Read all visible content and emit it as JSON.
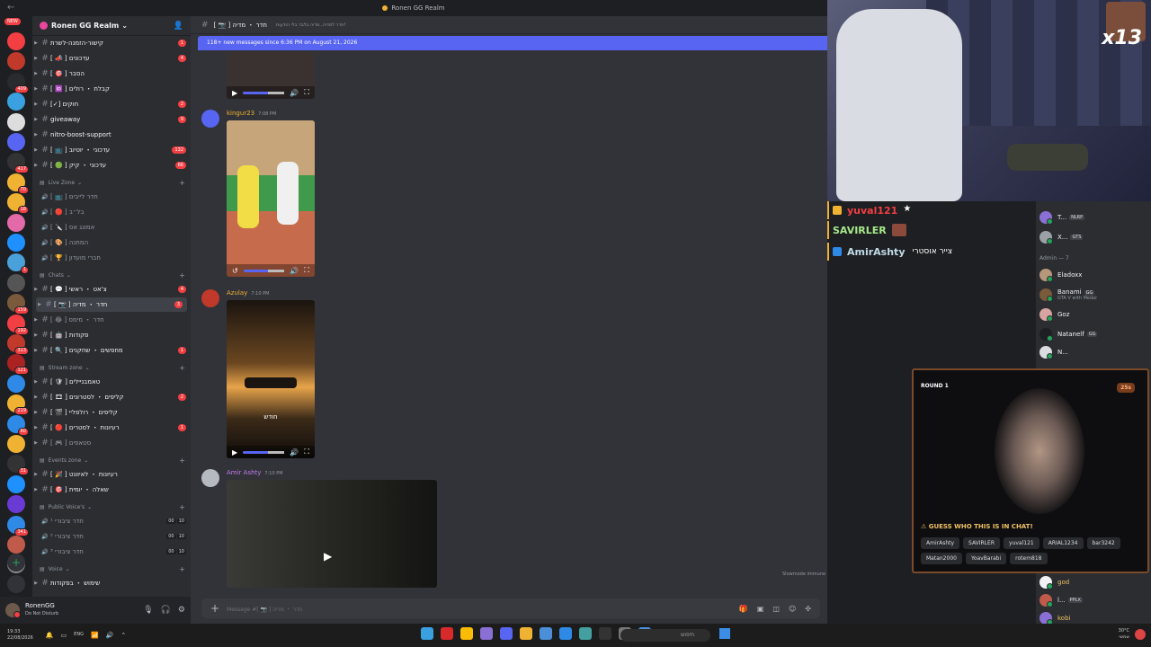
{
  "titlebar": {
    "title": "Ronen GG Realm",
    "back": "←"
  },
  "rail": {
    "new_badge": "NEW",
    "badges": [
      "",
      "",
      "409",
      "",
      "",
      "",
      "417",
      "70",
      "18",
      "",
      "",
      "1",
      "",
      "159",
      "192",
      "313",
      "121",
      "",
      "219",
      "60",
      "",
      "31",
      "",
      "",
      "341",
      "",
      ""
    ]
  },
  "server": {
    "name": "Ronen GG Realm",
    "chevron": "⌄"
  },
  "channels": [
    {
      "type": "text",
      "name": "קישור-הזמנה-לשרת",
      "badge": "1",
      "unread": true
    },
    {
      "type": "text",
      "name": "[ 📣 ] עדכונים",
      "badge": "4",
      "unread": true
    },
    {
      "type": "text",
      "name": "[ 🎯 ] הסבר",
      "badge": "",
      "unread": true
    },
    {
      "type": "text",
      "name": "[ 🆔 ] קבלת ・ רולים",
      "badge": "",
      "unread": true
    },
    {
      "type": "text",
      "name": "[✓] חוקים",
      "badge": "2",
      "unread": true
    },
    {
      "type": "text",
      "name": "giveaway",
      "badge": "9",
      "unread": true
    },
    {
      "type": "text",
      "name": "nitro-boost-support",
      "badge": "",
      "unread": true
    },
    {
      "type": "text",
      "name": "[ 📺 ] עדכוני ・ יוטיוב",
      "badge": "132",
      "unread": true
    },
    {
      "type": "text",
      "name": "[ 🟢 ] עדכוני ・ קיק",
      "badge": "66",
      "unread": true
    },
    {
      "type": "cat",
      "name": "Live Zone"
    },
    {
      "type": "voice",
      "name": "[ 📺 ] חדר לייבים"
    },
    {
      "type": "voice",
      "name": "[ 🔴 ] בל״ב"
    },
    {
      "type": "voice",
      "name": "[ 🔪 ] אמונג אס"
    },
    {
      "type": "voice",
      "name": "[ 🎨 ] המתנה"
    },
    {
      "type": "voice",
      "name": "[ 🏆 ] חברי מועדון"
    },
    {
      "type": "cat",
      "name": "Chats"
    },
    {
      "type": "text",
      "name": "[ 💬 ] צ'אט ・ ראשי",
      "badge": "4",
      "unread": true
    },
    {
      "type": "text",
      "name": "[ 📷 ] חדר ・ מדיה",
      "badge": "3",
      "unread": true,
      "selected": true
    },
    {
      "type": "text",
      "name": "[ 😂 ] חדר ・ מימס",
      "badge": "",
      "unread": false
    },
    {
      "type": "text",
      "name": "[ 🤖 ] פקודות",
      "badge": "",
      "unread": true
    },
    {
      "type": "text",
      "name": "[ 🔍 ] מחפשים ・ שחקנים",
      "badge": "1",
      "unread": true
    },
    {
      "type": "cat",
      "name": "Stream zone"
    },
    {
      "type": "text",
      "name": "[ 🛡 ] טאמבניילים",
      "badge": "",
      "unread": true
    },
    {
      "type": "text",
      "name": "[ 🎞 ] קליפים ・ לסטרונים",
      "badge": "2",
      "unread": true
    },
    {
      "type": "text",
      "name": "[ 🎬 ] קליפים ・ רולפליי",
      "badge": "",
      "unread": true
    },
    {
      "type": "text",
      "name": "[ 🔴 ] רעיונות ・ לסטרים",
      "badge": "1",
      "unread": true
    },
    {
      "type": "text",
      "name": "[ 🎮 ] סטאפים",
      "badge": "",
      "unread": false
    },
    {
      "type": "cat",
      "name": "Events zone"
    },
    {
      "type": "text",
      "name": "[ 🎉 ] רעיונות ・ לאיוונט",
      "badge": "",
      "unread": true
    },
    {
      "type": "text",
      "name": "[ 🎯 ] שאלה ・ יומית",
      "badge": "",
      "unread": true
    },
    {
      "type": "cat",
      "name": "Public Voice's"
    },
    {
      "type": "voicec",
      "name": "חדר ציבורי ¹",
      "c1": "00",
      "c2": "10"
    },
    {
      "type": "voicec",
      "name": "חדר ציבורי ²",
      "c1": "00",
      "c2": "10"
    },
    {
      "type": "voicec",
      "name": "חדר ציבורי ³",
      "c1": "00",
      "c2": "10"
    },
    {
      "type": "cat",
      "name": "Voice"
    },
    {
      "type": "text",
      "name": "שימוש ・ בפקודות",
      "badge": "",
      "unread": true
    }
  ],
  "user": {
    "name": "RonenGG",
    "status": "Do Not Disturb"
  },
  "channel_header": {
    "name": "[ 📷 ] חדר ・ מדיה",
    "topic": "חדר למדיה, מדיה בלבד בלי הודעות!"
  },
  "new_messages": "118+ new messages since 6:36 PM on August 21, 2026",
  "messages": [
    {
      "author": "kingur23",
      "time": "7:08 PM",
      "color": "#f0b232"
    },
    {
      "author": "Azulay",
      "time": "7:10 PM",
      "color": "#f0b232",
      "caption": "חודש"
    },
    {
      "author": "Amir Ashty",
      "time": "7:10 PM",
      "color": "#c27cf0"
    }
  ],
  "composer": {
    "placeholder": "Message #[ 📷 ] חדר ・ מדיה"
  },
  "slowmode": "Slowmode immune",
  "stream_overlay": {
    "multiplier": "x13"
  },
  "stream_chat": [
    {
      "name": "yuval121",
      "color": "#f23f43"
    },
    {
      "name": "SAVIRLER",
      "color": "#a6e88a"
    },
    {
      "name": "AmirAshty",
      "color": "#c0dbe8",
      "extra": "צייר אוסטרי"
    }
  ],
  "members": {
    "top": [
      {
        "name": "T...",
        "tag": "NLRP"
      },
      {
        "name": "X...",
        "tag": "GTS"
      }
    ],
    "admin_header": "Admin — 7",
    "admins": [
      {
        "name": "Eladoxx",
        "status": ""
      },
      {
        "name": "Banami",
        "status": "GTA V with Medal",
        "tag": "GG"
      },
      {
        "name": "Goz",
        "status": ""
      },
      {
        "name": "Natanelf",
        "status": "",
        "tag": "GG"
      },
      {
        "name": "N...",
        "status": ""
      }
    ],
    "bottom": [
      {
        "name": "god",
        "status": ""
      },
      {
        "name": "l...",
        "status": "",
        "tag": "PPLX"
      },
      {
        "name": "kobi",
        "status": ""
      }
    ]
  },
  "game": {
    "round": "ROUND 1",
    "timer": "25s",
    "question": "GUESS WHO THIS IS IN CHAT!",
    "options": [
      "AmirAshty",
      "SAVIRLER",
      "yuval121",
      "ARIAL1234",
      "bar3242",
      "Matan2000",
      "YoavBarabi",
      "rotem818"
    ]
  },
  "taskbar": {
    "time": "19:33",
    "date": "22/08/2026",
    "lang": "ENG",
    "search_placeholder": "חיפוש",
    "weather": "30°C",
    "weather_desc": "שמשי"
  },
  "colors": {
    "accent": "#5865f2",
    "unread_badge": "#f23f43",
    "online": "#23a55a"
  }
}
